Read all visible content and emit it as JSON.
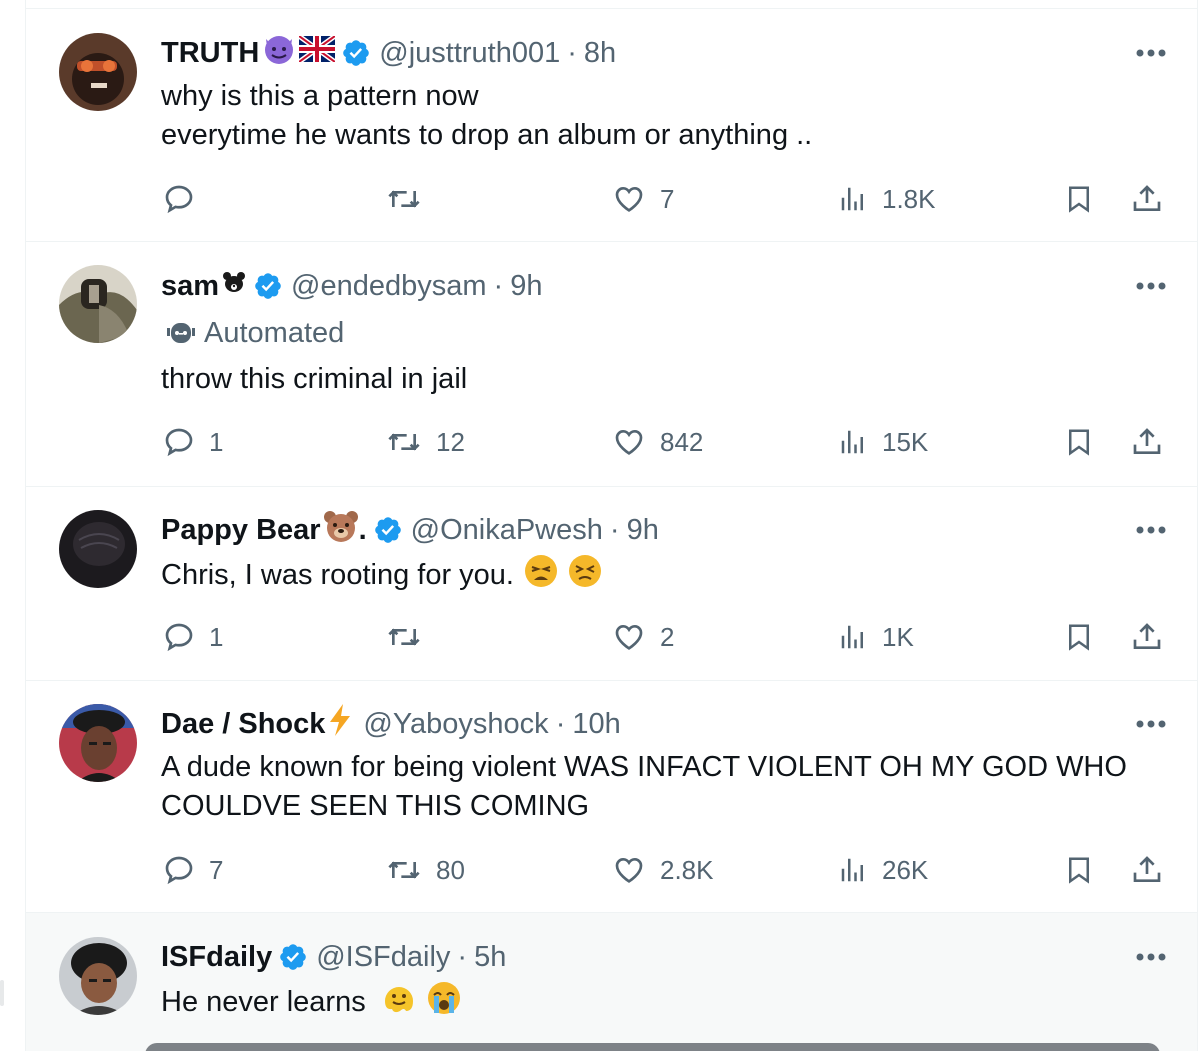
{
  "tweets": [
    {
      "name": "TRUTH",
      "handle": "@justtruth001",
      "separator": "·",
      "time": "8h",
      "text_lines": [
        "why is this a pattern now",
        "everytime he wants to drop an album or anything .."
      ],
      "replies": "",
      "retweets": "",
      "likes": "7",
      "views": "1.8K"
    },
    {
      "name": "sam",
      "handle": "@endedbysam",
      "separator": "·",
      "time": "9h",
      "automated_label": "Automated",
      "text_lines": [
        "throw this criminal in jail"
      ],
      "replies": "1",
      "retweets": "12",
      "likes": "842",
      "views": "15K"
    },
    {
      "name": "Pappy Bear",
      "name_suffix": ".",
      "handle": "@OnikaPwesh",
      "separator": "·",
      "time": "9h",
      "text_lines": [
        "Chris, I was rooting for you."
      ],
      "replies": "1",
      "retweets": "",
      "likes": "2",
      "views": "1K"
    },
    {
      "name": "Dae / Shock",
      "handle": "@Yaboyshock",
      "separator": "·",
      "time": "10h",
      "text_lines": [
        "A dude known for being violent WAS INFACT VIOLENT OH MY GOD WHO",
        "COULDVE SEEN THIS COMING"
      ],
      "replies": "7",
      "retweets": "80",
      "likes": "2.8K",
      "views": "26K"
    },
    {
      "name": "ISFdaily",
      "handle": "@ISFdaily",
      "separator": "·",
      "time": "5h",
      "text_lines": [
        "He never learns"
      ]
    }
  ],
  "colors": {
    "verified": "#1d9bf0",
    "text_primary": "#0f1419",
    "text_secondary": "#536471",
    "border": "#eff3f4",
    "highlight_bg": "#f7f9f9"
  },
  "icons": [
    "reply-icon",
    "retweet-icon",
    "like-icon",
    "views-icon",
    "bookmark-icon",
    "share-icon",
    "more-icon",
    "verified-badge-icon",
    "robot-icon"
  ]
}
